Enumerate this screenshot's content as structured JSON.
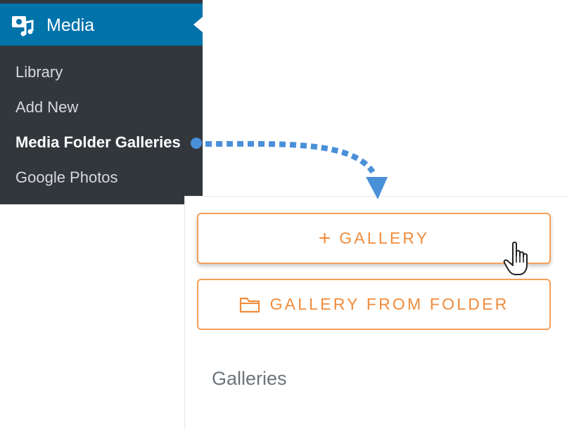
{
  "sidebar": {
    "header": {
      "title": "Media",
      "icon": "media-icon"
    },
    "items": [
      {
        "label": "Library",
        "current": false
      },
      {
        "label": "Add New",
        "current": false
      },
      {
        "label": "Media Folder Galleries",
        "current": true
      },
      {
        "label": "Google Photos",
        "current": false
      }
    ]
  },
  "panel": {
    "add_gallery": {
      "icon": "plus-icon",
      "label": "GALLERY"
    },
    "gallery_from_folder": {
      "icon": "folder-icon",
      "label": "GALLERY FROM FOLDER"
    },
    "galleries_heading": "Galleries"
  },
  "colors": {
    "sidebar_bg": "#32373c",
    "sidebar_active": "#0073aa",
    "button_accent": "#f08c3c",
    "connector": "#4a90d9"
  }
}
